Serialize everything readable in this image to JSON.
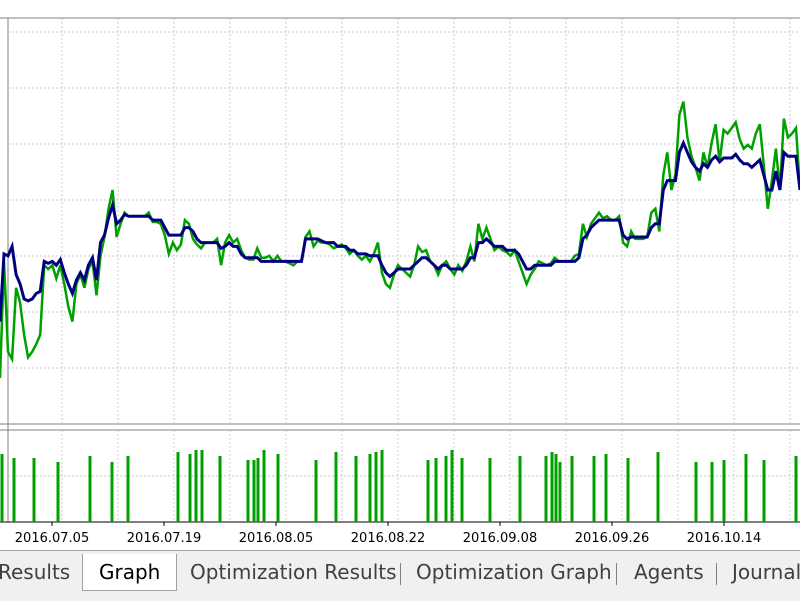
{
  "tabs": [
    {
      "label": "Results",
      "active": false
    },
    {
      "label": "Graph",
      "active": true
    },
    {
      "label": "Optimization Results",
      "active": false
    },
    {
      "label": "Optimization Graph",
      "active": false
    },
    {
      "label": "Agents",
      "active": false
    },
    {
      "label": "Journal",
      "active": false
    }
  ],
  "chart_data": {
    "type": "line",
    "title": "",
    "xlabel": "",
    "ylabel": "",
    "grid": true,
    "x_tick_labels": [
      "2016.07.05",
      "2016.07.19",
      "2016.08.05",
      "2016.08.22",
      "2016.09.08",
      "2016.09.26",
      "2016.10.14"
    ],
    "series": [
      {
        "color": "#00a000",
        "values": [
          0.0,
          0.62,
          0.14,
          0.1,
          0.48,
          0.4,
          0.23,
          0.11,
          0.14,
          0.18,
          0.23,
          0.6,
          0.58,
          0.6,
          0.53,
          0.6,
          0.5,
          0.38,
          0.3,
          0.5,
          0.55,
          0.48,
          0.58,
          0.62,
          0.44,
          0.65,
          0.75,
          0.9,
          1.0,
          0.75,
          0.82,
          0.88,
          0.86,
          0.86,
          0.86,
          0.86,
          0.86,
          0.88,
          0.83,
          0.83,
          0.82,
          0.76,
          0.66,
          0.72,
          0.68,
          0.71,
          0.84,
          0.82,
          0.74,
          0.71,
          0.69,
          0.72,
          0.72,
          0.72,
          0.74,
          0.6,
          0.72,
          0.76,
          0.72,
          0.74,
          0.68,
          0.64,
          0.63,
          0.63,
          0.69,
          0.64,
          0.64,
          0.65,
          0.62,
          0.65,
          0.62,
          0.62,
          0.61,
          0.6,
          0.62,
          0.62,
          0.75,
          0.78,
          0.7,
          0.73,
          0.72,
          0.72,
          0.71,
          0.69,
          0.7,
          0.71,
          0.69,
          0.66,
          0.68,
          0.65,
          0.63,
          0.65,
          0.62,
          0.66,
          0.72,
          0.56,
          0.5,
          0.48,
          0.55,
          0.6,
          0.58,
          0.56,
          0.54,
          0.6,
          0.7,
          0.67,
          0.68,
          0.62,
          0.6,
          0.55,
          0.6,
          0.62,
          0.58,
          0.55,
          0.6,
          0.57,
          0.62,
          0.7,
          0.62,
          0.82,
          0.74,
          0.8,
          0.74,
          0.68,
          0.7,
          0.68,
          0.67,
          0.65,
          0.68,
          0.62,
          0.56,
          0.5,
          0.55,
          0.58,
          0.62,
          0.61,
          0.6,
          0.61,
          0.64,
          0.62,
          0.62,
          0.62,
          0.62,
          0.65,
          0.66,
          0.82,
          0.75,
          0.82,
          0.85,
          0.88,
          0.85,
          0.86,
          0.84,
          0.84,
          0.86,
          0.72,
          0.7,
          0.78,
          0.74,
          0.74,
          0.74,
          0.75,
          0.88,
          0.9,
          0.78,
          1.08,
          1.2,
          1.0,
          1.08,
          1.4,
          1.47,
          1.28,
          1.18,
          1.12,
          1.05,
          1.2,
          1.12,
          1.25,
          1.35,
          1.15,
          1.32,
          1.3,
          1.33,
          1.36,
          1.27,
          1.22,
          1.24,
          1.22,
          1.3,
          1.35,
          1.13,
          0.9,
          1.05,
          1.22,
          1.0,
          1.38,
          1.28,
          1.3,
          1.33,
          1.0
        ],
        "labels_pixel_hint": null
      },
      {
        "color": "#000080",
        "values": [
          0.3,
          0.66,
          0.65,
          0.7,
          0.55,
          0.5,
          0.42,
          0.41,
          0.42,
          0.45,
          0.46,
          0.62,
          0.61,
          0.62,
          0.6,
          0.63,
          0.56,
          0.5,
          0.45,
          0.52,
          0.56,
          0.52,
          0.6,
          0.64,
          0.52,
          0.72,
          0.76,
          0.85,
          0.92,
          0.82,
          0.84,
          0.87,
          0.86,
          0.86,
          0.86,
          0.86,
          0.86,
          0.86,
          0.84,
          0.84,
          0.84,
          0.8,
          0.76,
          0.76,
          0.76,
          0.76,
          0.8,
          0.8,
          0.78,
          0.74,
          0.72,
          0.72,
          0.72,
          0.72,
          0.72,
          0.69,
          0.7,
          0.72,
          0.7,
          0.7,
          0.66,
          0.64,
          0.64,
          0.64,
          0.64,
          0.62,
          0.62,
          0.62,
          0.62,
          0.62,
          0.62,
          0.62,
          0.62,
          0.62,
          0.62,
          0.62,
          0.74,
          0.74,
          0.74,
          0.74,
          0.73,
          0.72,
          0.72,
          0.72,
          0.7,
          0.7,
          0.7,
          0.68,
          0.68,
          0.66,
          0.66,
          0.66,
          0.65,
          0.65,
          0.65,
          0.6,
          0.56,
          0.54,
          0.56,
          0.58,
          0.58,
          0.58,
          0.58,
          0.6,
          0.62,
          0.64,
          0.64,
          0.62,
          0.6,
          0.58,
          0.6,
          0.6,
          0.58,
          0.58,
          0.58,
          0.58,
          0.6,
          0.64,
          0.64,
          0.72,
          0.72,
          0.74,
          0.72,
          0.7,
          0.7,
          0.7,
          0.68,
          0.68,
          0.68,
          0.66,
          0.62,
          0.58,
          0.58,
          0.6,
          0.6,
          0.6,
          0.6,
          0.6,
          0.62,
          0.62,
          0.62,
          0.62,
          0.62,
          0.62,
          0.64,
          0.74,
          0.76,
          0.8,
          0.82,
          0.84,
          0.84,
          0.84,
          0.84,
          0.84,
          0.84,
          0.76,
          0.74,
          0.75,
          0.75,
          0.75,
          0.75,
          0.75,
          0.8,
          0.82,
          0.82,
          1.0,
          1.05,
          1.05,
          1.05,
          1.2,
          1.25,
          1.2,
          1.15,
          1.12,
          1.1,
          1.14,
          1.12,
          1.16,
          1.18,
          1.15,
          1.17,
          1.17,
          1.17,
          1.19,
          1.16,
          1.14,
          1.14,
          1.12,
          1.14,
          1.16,
          1.08,
          1.0,
          1.0,
          1.1,
          1.0,
          1.2,
          1.18,
          1.18,
          1.18,
          1.0
        ]
      }
    ],
    "volume_bars": {
      "color": "#00a000",
      "count": 54
    }
  }
}
